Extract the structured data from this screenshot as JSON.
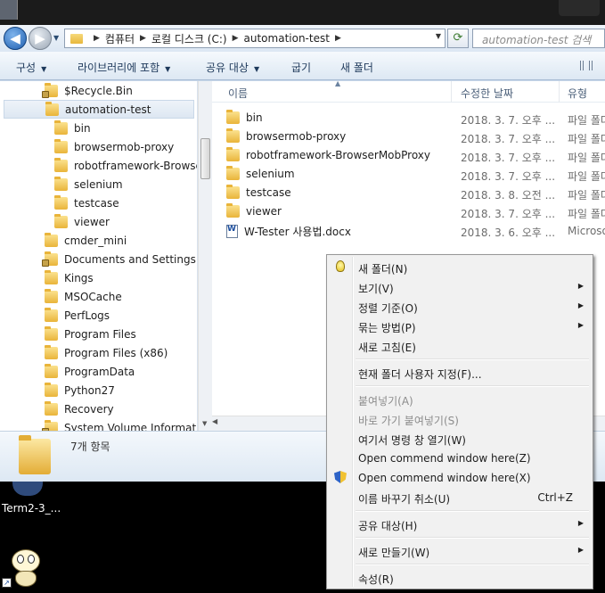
{
  "address": {
    "segments": [
      "컴퓨터",
      "로컬 디스크 (C:)",
      "automation-test"
    ],
    "search_placeholder": "automation-test 검색"
  },
  "toolbar": {
    "organize": "구성",
    "include_library": "라이브러리에 포함",
    "share_with": "공유 대상",
    "burn": "굽기",
    "new_folder": "새 폴더"
  },
  "nav_tree": [
    {
      "label": "$Recycle.Bin",
      "indent": 1,
      "locked": true
    },
    {
      "label": "automation-test",
      "indent": 1,
      "selected": true
    },
    {
      "label": "bin",
      "indent": 2
    },
    {
      "label": "browsermob-proxy",
      "indent": 2
    },
    {
      "label": "robotframework-BrowserMobProxy",
      "indent": 2
    },
    {
      "label": "selenium",
      "indent": 2
    },
    {
      "label": "testcase",
      "indent": 2
    },
    {
      "label": "viewer",
      "indent": 2
    },
    {
      "label": "cmder_mini",
      "indent": 1
    },
    {
      "label": "Documents and Settings",
      "indent": 1,
      "locked": true
    },
    {
      "label": "Kings",
      "indent": 1
    },
    {
      "label": "MSOCache",
      "indent": 1
    },
    {
      "label": "PerfLogs",
      "indent": 1
    },
    {
      "label": "Program Files",
      "indent": 1
    },
    {
      "label": "Program Files (x86)",
      "indent": 1
    },
    {
      "label": "ProgramData",
      "indent": 1
    },
    {
      "label": "Python27",
      "indent": 1
    },
    {
      "label": "Recovery",
      "indent": 1
    },
    {
      "label": "System Volume Information",
      "indent": 1,
      "locked": true
    }
  ],
  "columns": {
    "name": "이름",
    "modified": "수정한 날짜",
    "type": "유형"
  },
  "files": [
    {
      "name": "bin",
      "date": "2018. 3. 7. 오후 ...",
      "type": "파일 폴더",
      "kind": "folder"
    },
    {
      "name": "browsermob-proxy",
      "date": "2018. 3. 7. 오후 ...",
      "type": "파일 폴더",
      "kind": "folder"
    },
    {
      "name": "robotframework-BrowserMobProxy",
      "date": "2018. 3. 7. 오후 ...",
      "type": "파일 폴더",
      "kind": "folder"
    },
    {
      "name": "selenium",
      "date": "2018. 3. 7. 오후 ...",
      "type": "파일 폴더",
      "kind": "folder"
    },
    {
      "name": "testcase",
      "date": "2018. 3. 8. 오전 ...",
      "type": "파일 폴더",
      "kind": "folder"
    },
    {
      "name": "viewer",
      "date": "2018. 3. 7. 오후 ...",
      "type": "파일 폴더",
      "kind": "folder"
    },
    {
      "name": "W-Tester 사용법.docx",
      "date": "2018. 3. 6. 오후 ...",
      "type": "Microsoft",
      "kind": "doc"
    }
  ],
  "details": {
    "item_count": "7개 항목"
  },
  "desktop": {
    "shortcut_label": "Term2-3_..."
  },
  "context_menu": {
    "new_folder": "새 폴더(N)",
    "view": "보기(V)",
    "sort_by": "정렬 기준(O)",
    "group_by": "묶는 방법(P)",
    "refresh": "새로 고침(E)",
    "customize": "현재 폴더 사용자 지정(F)...",
    "paste": "붙여넣기(A)",
    "paste_shortcut": "바로 가기 붙여넣기(S)",
    "open_cmd_here": "여기서 명령 창 열기(W)",
    "open_cmd_z": "Open commend window here(Z)",
    "open_cmd_x": "Open commend window here(X)",
    "undo_rename": "이름 바꾸기 취소(U)",
    "undo_shortcut": "Ctrl+Z",
    "share_with": "공유 대상(H)",
    "new": "새로 만들기(W)",
    "properties": "속성(R)"
  }
}
